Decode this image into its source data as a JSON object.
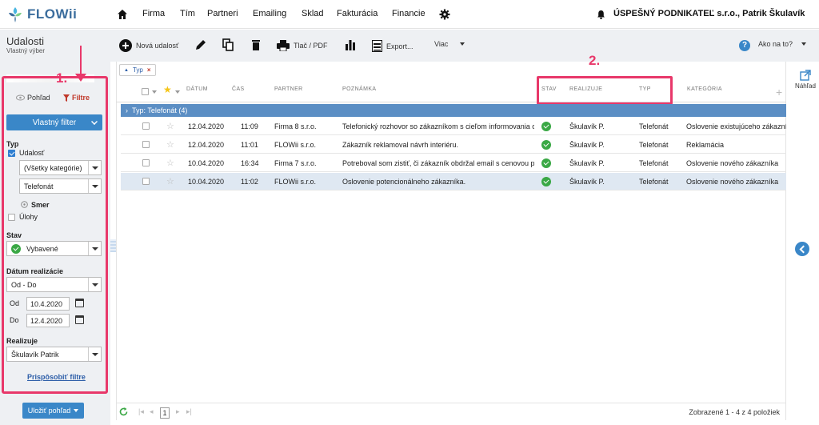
{
  "brand": {
    "logo_text": "FLOWii"
  },
  "nav": {
    "items": [
      "Firma",
      "Tím",
      "Partneri",
      "Emailing",
      "Sklad",
      "Fakturácia",
      "Financie"
    ],
    "company": "ÚSPEŠNÝ PODNIKATEĽ s.r.o., Patrik Škulavík"
  },
  "sidebar": {
    "title": "Udalosti",
    "subtitle": "Vlastný výber",
    "view_tab": "Pohľad",
    "filter_tab": "Filtre",
    "custom_filter_button": "Vlastný filter",
    "type_label": "Typ",
    "event_checkbox": "Udalosť",
    "category_select": "(Všetky kategórie)",
    "type_select": "Telefonát",
    "direction_label": "Smer",
    "tasks_checkbox": "Úlohy",
    "status_label": "Stav",
    "status_select": "Vybavené",
    "date_label": "Dátum realizácie",
    "date_range_select": "Od - Do",
    "from_label": "Od",
    "from_value": "10.4.2020",
    "to_label": "Do",
    "to_value": "12.4.2020",
    "assignee_label": "Realizuje",
    "assignee_select": "Škulavík Patrik",
    "customize_link": "Prispôsobiť filtre",
    "save_view_button": "Uložiť pohľad"
  },
  "annotations": {
    "marker_1": "1.",
    "marker_2": "2."
  },
  "toolbar": {
    "new_event": "Nová udalosť",
    "print_pdf": "Tlač / PDF",
    "export": "Export...",
    "more": "Viac",
    "help": "Ako na to?"
  },
  "filter_tag": {
    "label": "Typ"
  },
  "table": {
    "headers": {
      "date": "DÁTUM",
      "time": "ČAS",
      "partner": "PARTNER",
      "note": "POZNÁMKA",
      "status": "STAV",
      "assignee": "REALIZUJE",
      "type": "TYP",
      "category": "KATEGÓRIA"
    },
    "group_label": "Typ: Telefonát (4)",
    "rows": [
      {
        "date": "12.04.2020",
        "time": "11:09",
        "partner": "Firma 8 s.r.o.",
        "note": "Telefonický rozhovor so zákazníkom s cieľom informovania o...",
        "assignee": "Škulavík P.",
        "type": "Telefonát",
        "category": "Oslovenie existujúceho zákazník"
      },
      {
        "date": "12.04.2020",
        "time": "11:01",
        "partner": "FLOWii s.r.o.",
        "note": "Zákazník reklamoval návrh interiéru.",
        "assignee": "Škulavík P.",
        "type": "Telefonát",
        "category": "Reklamácia"
      },
      {
        "date": "10.04.2020",
        "time": "16:34",
        "partner": "Firma 7 s.r.o.",
        "note": "Potreboval som zistiť, či zákazník obdržal email s cenovou po...",
        "assignee": "Škulavík P.",
        "type": "Telefonát",
        "category": "Oslovenie nového zákazníka"
      },
      {
        "date": "10.04.2020",
        "time": "11:02",
        "partner": "FLOWii s.r.o.",
        "note": "Oslovenie potencionálneho zákazníka.",
        "assignee": "Škulavík P.",
        "type": "Telefonát",
        "category": "Oslovenie nového zákazníka"
      }
    ]
  },
  "footer": {
    "page": "1",
    "summary": "Zobrazené 1 - 4 z 4 položiek"
  },
  "right_panel": {
    "preview": "Náhľad"
  },
  "colors": {
    "accent": "#3a87c8",
    "annotation": "#e8386a",
    "group_row": "#5b8ec4",
    "status_ok": "#3aa845"
  }
}
